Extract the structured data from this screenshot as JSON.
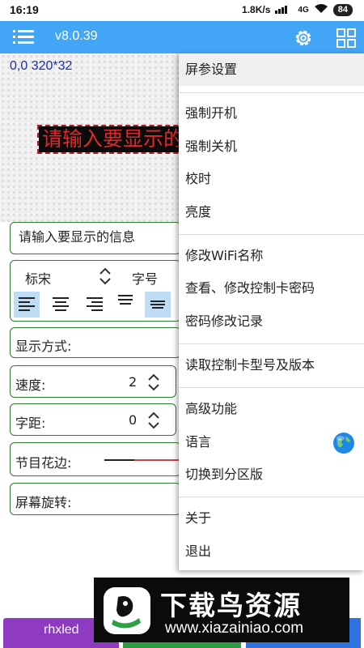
{
  "statusbar": {
    "time": "16:19",
    "speed": "1.8K/s",
    "network": "4G",
    "battery": "84"
  },
  "appbar": {
    "version": "v8.0.39"
  },
  "preview": {
    "coords": "0,0 320*32",
    "led_text": "请输入要显示的信息"
  },
  "form": {
    "message": "请输入要显示的信息",
    "font_name": "标宋",
    "font_size_label": "字号",
    "display_mode_label": "显示方式:",
    "speed_label": "速度:",
    "speed_value": "2",
    "spacing_label": "字距:",
    "spacing_value": "0",
    "border_label": "节目花边:",
    "rotate_label": "屏幕旋转:"
  },
  "menu": {
    "items": [
      "屏参设置",
      "强制开机",
      "强制关机",
      "校时",
      "亮度",
      "修改WiFi名称",
      "查看、修改控制卡密码",
      "密码修改记录",
      "读取控制卡型号及版本",
      "高级功能",
      "语言",
      "切换到分区版",
      "关于",
      "退出"
    ]
  },
  "watermark": {
    "title": "下载鸟资源",
    "url": "www.xiazainiao.com"
  },
  "bottom": {
    "left_label": "rhxled"
  },
  "colors": {
    "accent": "#42a5f5",
    "border": "#2e7d32",
    "led_text": "#e3262c"
  }
}
